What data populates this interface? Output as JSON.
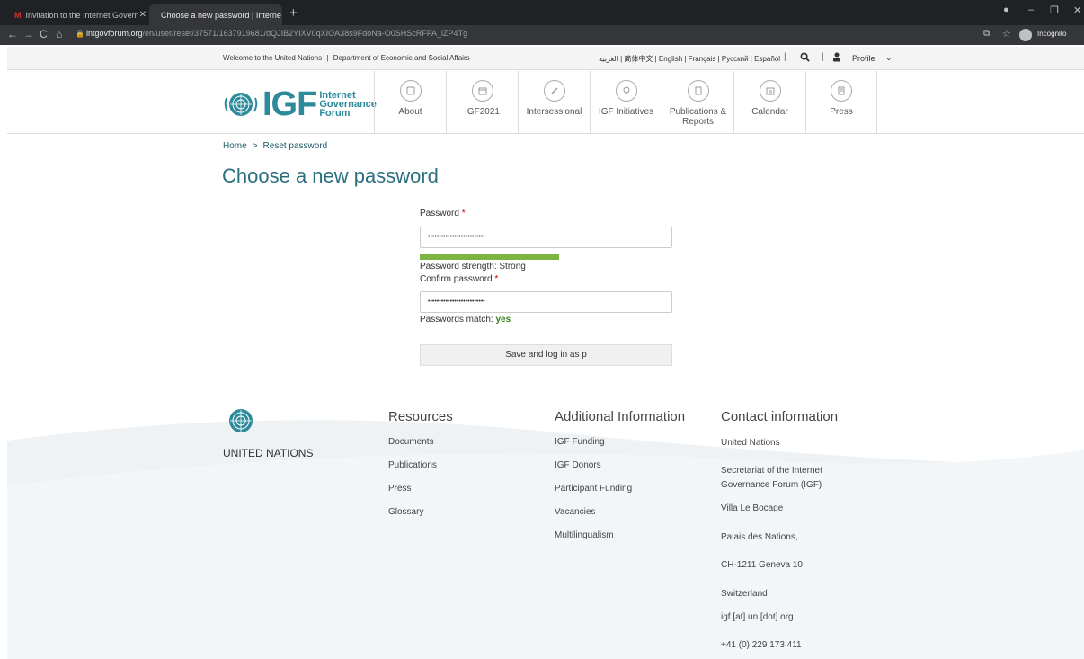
{
  "browser": {
    "tabs": [
      {
        "title": "Invitation to the Internet Govern"
      },
      {
        "title": "Choose a new password | Interne"
      }
    ],
    "url_host": "intgovforum.org",
    "url_path": "/en/user/reset/37571/1637919681/dQJIB2YIXV0qXIOA38s9FdoNa-O0SHScRFPA_iZP4Tg",
    "incognito_label": "Incognito"
  },
  "topstrip": {
    "welcome": "Welcome to the United Nations",
    "department": "Department of Economic and Social Affairs",
    "languages": "العربية | 简体中文 | English | Français | Русский | Español",
    "profile": "Profile"
  },
  "header": {
    "logo_main": "IGF",
    "logo_sub1": "Internet",
    "logo_sub2": "Governance",
    "logo_sub3": "Forum",
    "nav": [
      {
        "label": "About"
      },
      {
        "label": "IGF2021"
      },
      {
        "label": "Intersessional"
      },
      {
        "label": "IGF Initiatives"
      },
      {
        "label": "Publications &",
        "label2": "Reports"
      },
      {
        "label": "Calendar"
      },
      {
        "label": "Press"
      }
    ]
  },
  "main": {
    "breadcrumb_home": "Home",
    "breadcrumb_current": "Reset password",
    "title": "Choose a new password",
    "password_label": "Password",
    "required_mark": "*",
    "password_value": "••••••••••••••••••••••••••",
    "strength_text": "Password strength: Strong",
    "strength_fraction": 0.55,
    "confirm_label": "Confirm password",
    "confirm_value": "••••••••••••••••••••••••••",
    "match_text": "Passwords match:",
    "match_value": "yes",
    "submit_label": "Save and log in as p"
  },
  "footer": {
    "un_label": "UNITED NATIONS",
    "resources": {
      "heading": "Resources",
      "links": [
        "Documents",
        "Publications",
        "Press",
        "Glossary"
      ]
    },
    "additional": {
      "heading": "Additional Information",
      "links": [
        "IGF Funding",
        "IGF Donors",
        "Participant Funding",
        "Vacancies",
        "Multilingualism"
      ]
    },
    "contact": {
      "heading": "Contact information",
      "lines": [
        "United Nations",
        "Secretariat of the Internet",
        "Governance Forum (IGF)",
        "Villa Le Bocage",
        "Palais des Nations,",
        "CH-1211 Geneva 10",
        "Switzerland",
        "igf [at] un [dot] org",
        "+41 (0) 229 173 411"
      ]
    }
  },
  "colors": {
    "brand": "#2c8a9a",
    "strength": "#7cb342",
    "match_yes": "#3a7d1f"
  },
  "icons": [
    "search-icon",
    "profile-icon",
    "chevron-down-icon",
    "un-emblem-icon",
    "lock-icon",
    "star-icon",
    "incognito-icon"
  ]
}
